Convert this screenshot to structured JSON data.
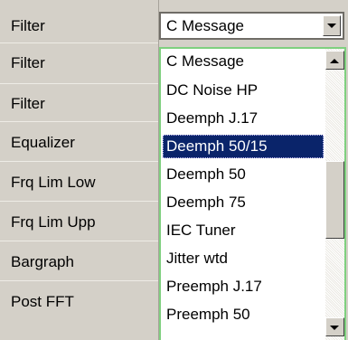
{
  "panel": {
    "labels": [
      "Filter",
      "Filter",
      "Filter",
      "Equalizer",
      "Frq Lim Low",
      "Frq Lim Upp",
      "Bargraph",
      "Post FFT"
    ]
  },
  "filter_combo": {
    "selected_value": "C Message"
  },
  "dropdown": {
    "options": [
      "C Message",
      "DC Noise HP",
      "Deemph J.17",
      "Deemph 50/15",
      "Deemph 50",
      "Deemph 75",
      "IEC Tuner",
      "Jitter wtd",
      "Preemph J.17",
      "Preemph 50"
    ],
    "highlighted_option": "Deemph 50/15"
  },
  "colors": {
    "background": "#d4d0c8",
    "selection": "#0a246a",
    "list_border": "#7fd07f"
  },
  "icons": {
    "combo_arrow": "chevron-down-icon",
    "scroll_up": "arrow-up-icon",
    "scroll_down": "arrow-down-icon"
  }
}
